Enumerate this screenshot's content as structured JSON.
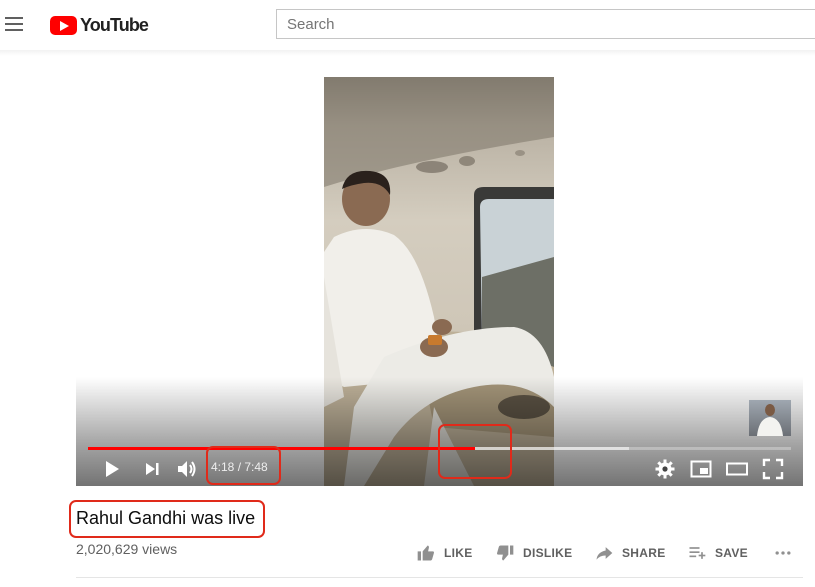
{
  "header": {
    "logo_text": "YouTube",
    "search_placeholder": "Search"
  },
  "player": {
    "current_time": "4:18",
    "duration": "7:48",
    "time_display": "4:18 / 7:48",
    "played_fraction": 0.55,
    "buffered_fraction": 0.77
  },
  "video": {
    "title": "Rahul Gandhi was live",
    "views": "2,020,629 views"
  },
  "actions": {
    "like": "LIKE",
    "dislike": "DISLIKE",
    "share": "SHARE",
    "save": "SAVE"
  },
  "colors": {
    "brand_red": "#ff0000",
    "annotation_red": "#e02a1a",
    "action_grey": "#606060"
  },
  "icons": [
    "menu-icon",
    "youtube-logo-icon",
    "play-icon",
    "next-icon",
    "volume-icon",
    "settings-icon",
    "miniplayer-icon",
    "theater-icon",
    "fullscreen-icon",
    "like-icon",
    "dislike-icon",
    "share-icon",
    "save-playlist-icon",
    "more-icon"
  ]
}
